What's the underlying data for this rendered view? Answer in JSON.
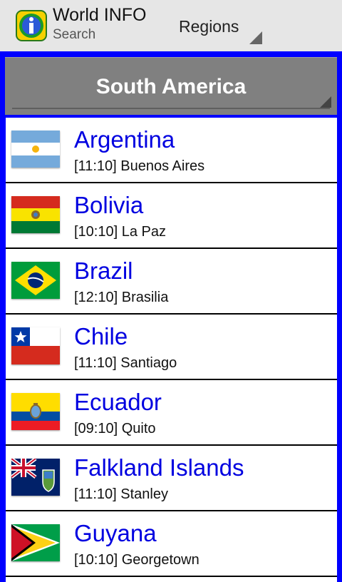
{
  "app": {
    "title": "World INFO",
    "subtitle": "Search",
    "icon": "info-globe-icon"
  },
  "regions_menu": {
    "label": "Regions"
  },
  "region": {
    "name": "South America"
  },
  "countries": [
    {
      "name": "Argentina",
      "time": "[11:10]",
      "capital": "Buenos Aires",
      "flag": "argentina-flag-icon"
    },
    {
      "name": "Bolivia",
      "time": "[10:10]",
      "capital": "La Paz",
      "flag": "bolivia-flag-icon"
    },
    {
      "name": "Brazil",
      "time": "[12:10]",
      "capital": "Brasilia",
      "flag": "brazil-flag-icon"
    },
    {
      "name": "Chile",
      "time": "[11:10]",
      "capital": "Santiago",
      "flag": "chile-flag-icon"
    },
    {
      "name": "Ecuador",
      "time": "[09:10]",
      "capital": "Quito",
      "flag": "ecuador-flag-icon"
    },
    {
      "name": "Falkland Islands",
      "time": "[11:10]",
      "capital": "Stanley",
      "flag": "falkland-islands-flag-icon"
    },
    {
      "name": "Guyana",
      "time": "[10:10]",
      "capital": "Georgetown",
      "flag": "guyana-flag-icon"
    }
  ],
  "colors": {
    "frame": "#0000ff",
    "country_name": "#0000e0",
    "header_bg": "#808080",
    "actionbar_bg": "#e6e6e6"
  }
}
